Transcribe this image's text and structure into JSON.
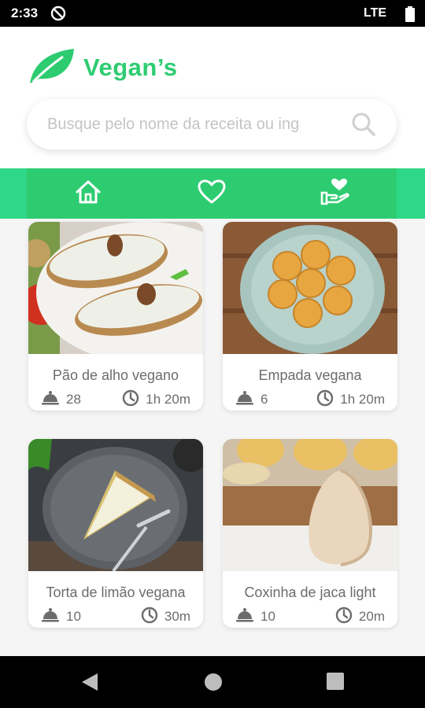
{
  "status": {
    "time": "2:33",
    "network": "LTE"
  },
  "app": {
    "name": "Vegan’s"
  },
  "search": {
    "placeholder": "Busque pelo nome da receita ou ing"
  },
  "colors": {
    "brand": "#2ecc71",
    "text": "#6c6c6c"
  },
  "nav": [
    {
      "icon": "home-icon"
    },
    {
      "icon": "heart-icon"
    },
    {
      "icon": "donate-hand-icon"
    }
  ],
  "recipes": [
    {
      "title": "Pão de alho vegano",
      "servings": "28",
      "time": "1h 20m"
    },
    {
      "title": "Empada vegana",
      "servings": "6",
      "time": "1h 20m"
    },
    {
      "title": "Torta de limão vegana",
      "servings": "10",
      "time": "30m"
    },
    {
      "title": "Coxinha de jaca light",
      "servings": "10",
      "time": "20m"
    }
  ]
}
